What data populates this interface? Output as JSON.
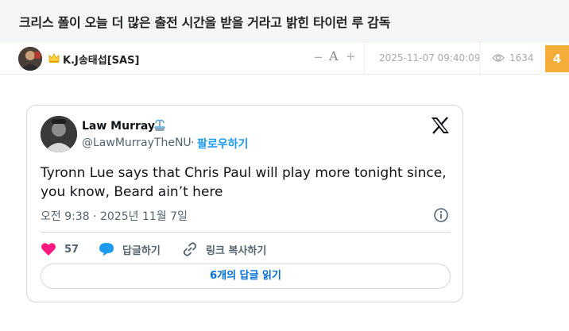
{
  "post": {
    "title": "크리스 폴이 오늘 더 많은 출전 시간을 받을 거라고 밝힌 타이런 루 감독"
  },
  "meta": {
    "author": "K.J송태섭[SAS]",
    "font_minus": "−",
    "font_label": "A",
    "font_plus": "+",
    "date": "2025-11-07 09:40:09",
    "views": "1634",
    "comments": "4",
    "accent_color": "#f5ad3a"
  },
  "tweet": {
    "name": "Law Murray",
    "handle": "@LawMurrayTheNU",
    "dot": "·",
    "follow_label": "팔로우하기",
    "text": "Tyronn Lue says that Chris Paul will play more tonight since, you know, Beard ain’t here",
    "time": "오전 9:38 · 2025년 11월 7일",
    "likes": "57",
    "reply_label": "답글하기",
    "copy_label": "링크 복사하기",
    "read_replies_label": "6개의 답글 읽기",
    "icons": {
      "like": "heart-icon",
      "reply": "speech-bubble-icon",
      "copy": "link-icon",
      "info": "info-icon",
      "brand": "x-logo-icon",
      "badge": "fountain-icon"
    },
    "colors": {
      "like": "#f91880",
      "reply": "#1d9bf0",
      "link": "#006fd6"
    }
  }
}
